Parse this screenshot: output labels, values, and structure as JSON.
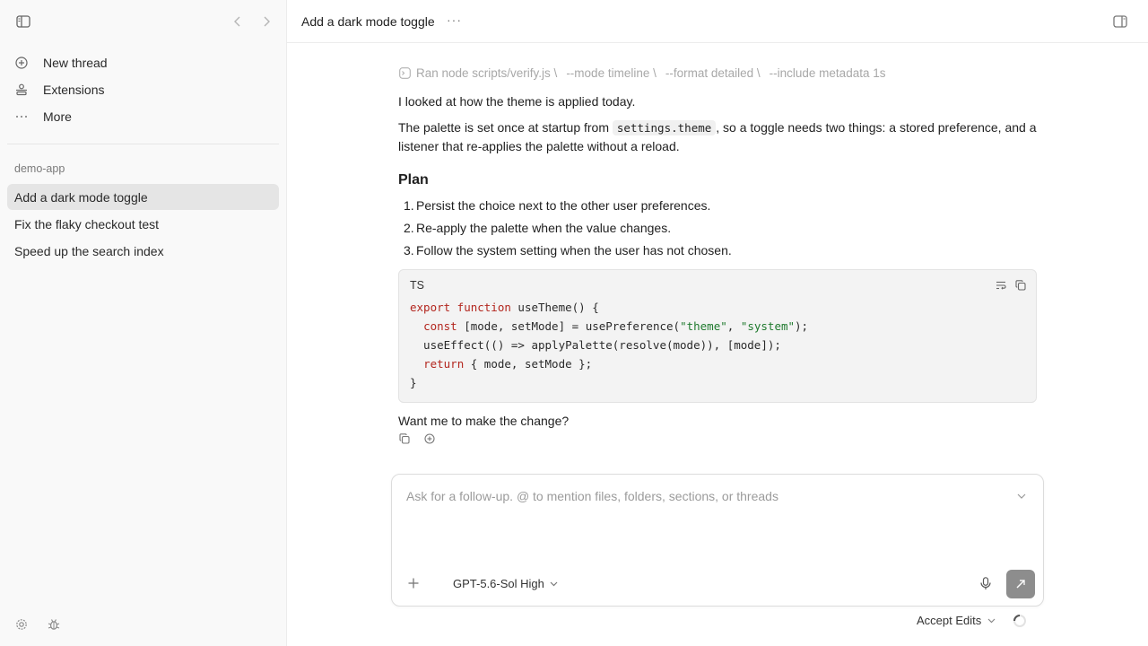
{
  "sidebar": {
    "nav": [
      {
        "label": "New thread",
        "icon": "plus-circle-icon"
      },
      {
        "label": "Extensions",
        "icon": "extensions-icon"
      },
      {
        "label": "More",
        "icon": "more-dots-icon"
      }
    ],
    "project": "demo-app",
    "threads": [
      {
        "label": "Add a dark mode toggle",
        "active": true
      },
      {
        "label": "Fix the flaky checkout test",
        "active": false
      },
      {
        "label": "Speed up the search index",
        "active": false
      }
    ]
  },
  "header": {
    "title": "Add a dark mode toggle",
    "more": "···"
  },
  "message": {
    "command": {
      "prefix": "Ran node scripts/verify.js \\",
      "args": [
        "--mode timeline \\",
        "--format detailed \\",
        "--include metadata 1s"
      ]
    },
    "p1": "I looked at how the theme is applied today.",
    "p2_before": "The palette is set once at startup from ",
    "p2_code": "settings.theme",
    "p2_after": ", so a toggle needs two things: a stored preference, and a listener that re-applies the palette without a reload.",
    "plan_heading": "Plan",
    "plan": [
      {
        "num": "1.",
        "text": "Persist the choice next to the other user preferences."
      },
      {
        "num": "2.",
        "text": "Re-apply the palette when the value changes."
      },
      {
        "num": "3.",
        "text": "Follow the system setting when the user has not chosen."
      }
    ],
    "code": {
      "lang": "TS",
      "lines": [
        "export function useTheme() {",
        "  const [mode, setMode] = usePreference(\"theme\", \"system\");",
        "  useEffect(() => applyPalette(resolve(mode)), [mode]);",
        "  return { mode, setMode };",
        "}"
      ]
    },
    "closing": "Want me to make the change?"
  },
  "composer": {
    "placeholder": "Ask for a follow-up. @ to mention files, folders, sections, or threads",
    "model": "GPT-5.6-Sol High"
  },
  "footer": {
    "accept": "Accept Edits"
  },
  "colors": {
    "sidebar_bg": "#f9f9f9",
    "active_thread": "#e5e5e5",
    "keyword": "#b3261e",
    "string": "#1f7a2e",
    "send_button": "#8d8d8d"
  }
}
